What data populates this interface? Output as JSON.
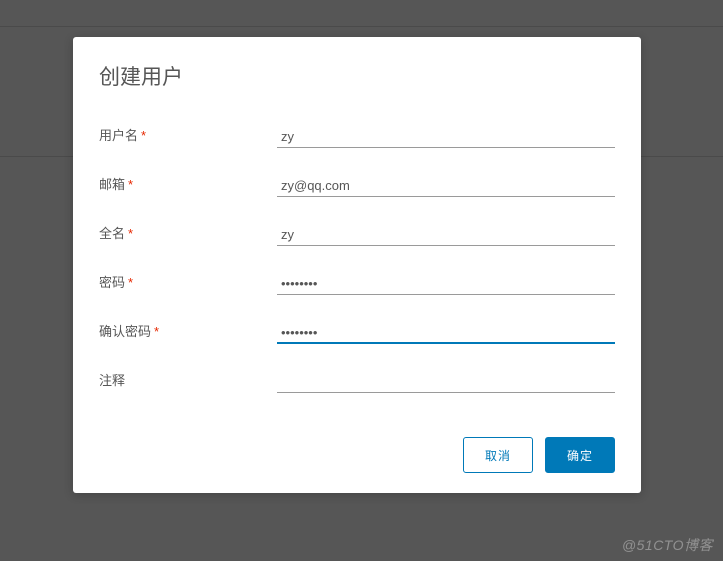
{
  "modal": {
    "title": "创建用户",
    "fields": {
      "username": {
        "label": "用户名",
        "value": "zy",
        "required": true
      },
      "email": {
        "label": "邮箱",
        "value": "zy@qq.com",
        "required": true
      },
      "fullname": {
        "label": "全名",
        "value": "zy",
        "required": true
      },
      "password": {
        "label": "密码",
        "value": "••••••••",
        "required": true
      },
      "confirm_password": {
        "label": "确认密码",
        "value": "••••••••",
        "required": true
      },
      "comment": {
        "label": "注释",
        "value": "",
        "required": false
      }
    },
    "buttons": {
      "cancel": "取消",
      "ok": "确定"
    }
  },
  "watermark": "@51CTO博客"
}
